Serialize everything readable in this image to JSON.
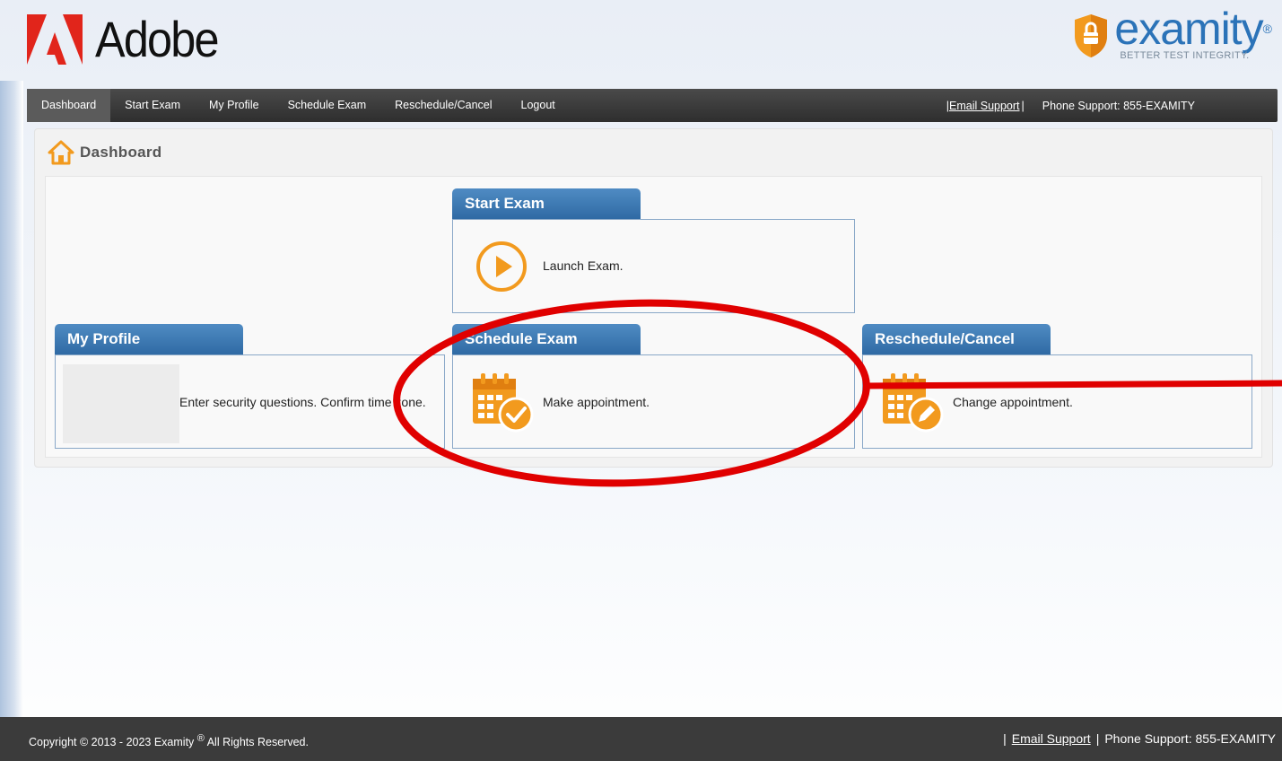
{
  "brand": {
    "company_name": "Adobe",
    "proctor_name": "examity",
    "proctor_registered": "®",
    "proctor_tagline": "BETTER TEST INTEGRITY.",
    "colors": {
      "nav_bg": "#333333",
      "card_header": "#3a75ae",
      "accent_orange": "#f29a1e",
      "annotation_red": "#e00000",
      "proctor_blue": "#2b73b8",
      "adobe_red": "#e1251b"
    }
  },
  "nav": {
    "items": [
      {
        "label": "Dashboard",
        "active": true
      },
      {
        "label": "Start Exam",
        "active": false
      },
      {
        "label": "My Profile",
        "active": false
      },
      {
        "label": "Schedule Exam",
        "active": false
      },
      {
        "label": "Reschedule/Cancel",
        "active": false
      },
      {
        "label": "Logout",
        "active": false
      }
    ],
    "email_support_prefix": "|",
    "email_support_label": "Email Support",
    "email_support_suffix": "|",
    "phone_support": "Phone Support: 855-EXAMITY"
  },
  "page": {
    "title": "Dashboard",
    "icon": "home-icon"
  },
  "cards": {
    "start_exam": {
      "title": "Start Exam",
      "text": "Launch Exam.",
      "icon": "play-icon"
    },
    "my_profile": {
      "title": "My Profile",
      "text": "Enter security questions. Confirm time zone.",
      "icon": "profile-image-placeholder"
    },
    "schedule_exam": {
      "title": "Schedule Exam",
      "text": "Make appointment.",
      "icon": "calendar-check-icon"
    },
    "reschedule_cancel": {
      "title": "Reschedule/Cancel",
      "text": "Change appointment.",
      "icon": "calendar-edit-icon"
    }
  },
  "annotation": {
    "shape": "ellipse-with-arrow",
    "target": "schedule_exam",
    "color": "#e00000"
  },
  "footer": {
    "copyright": "Copyright © 2013 - 2023 Examity",
    "registered": "®",
    "rights": "All Rights Reserved.",
    "divider_left": "|",
    "email_support_label": "Email Support",
    "divider_mid": "|",
    "phone_support": "Phone Support: 855-EXAMITY"
  }
}
